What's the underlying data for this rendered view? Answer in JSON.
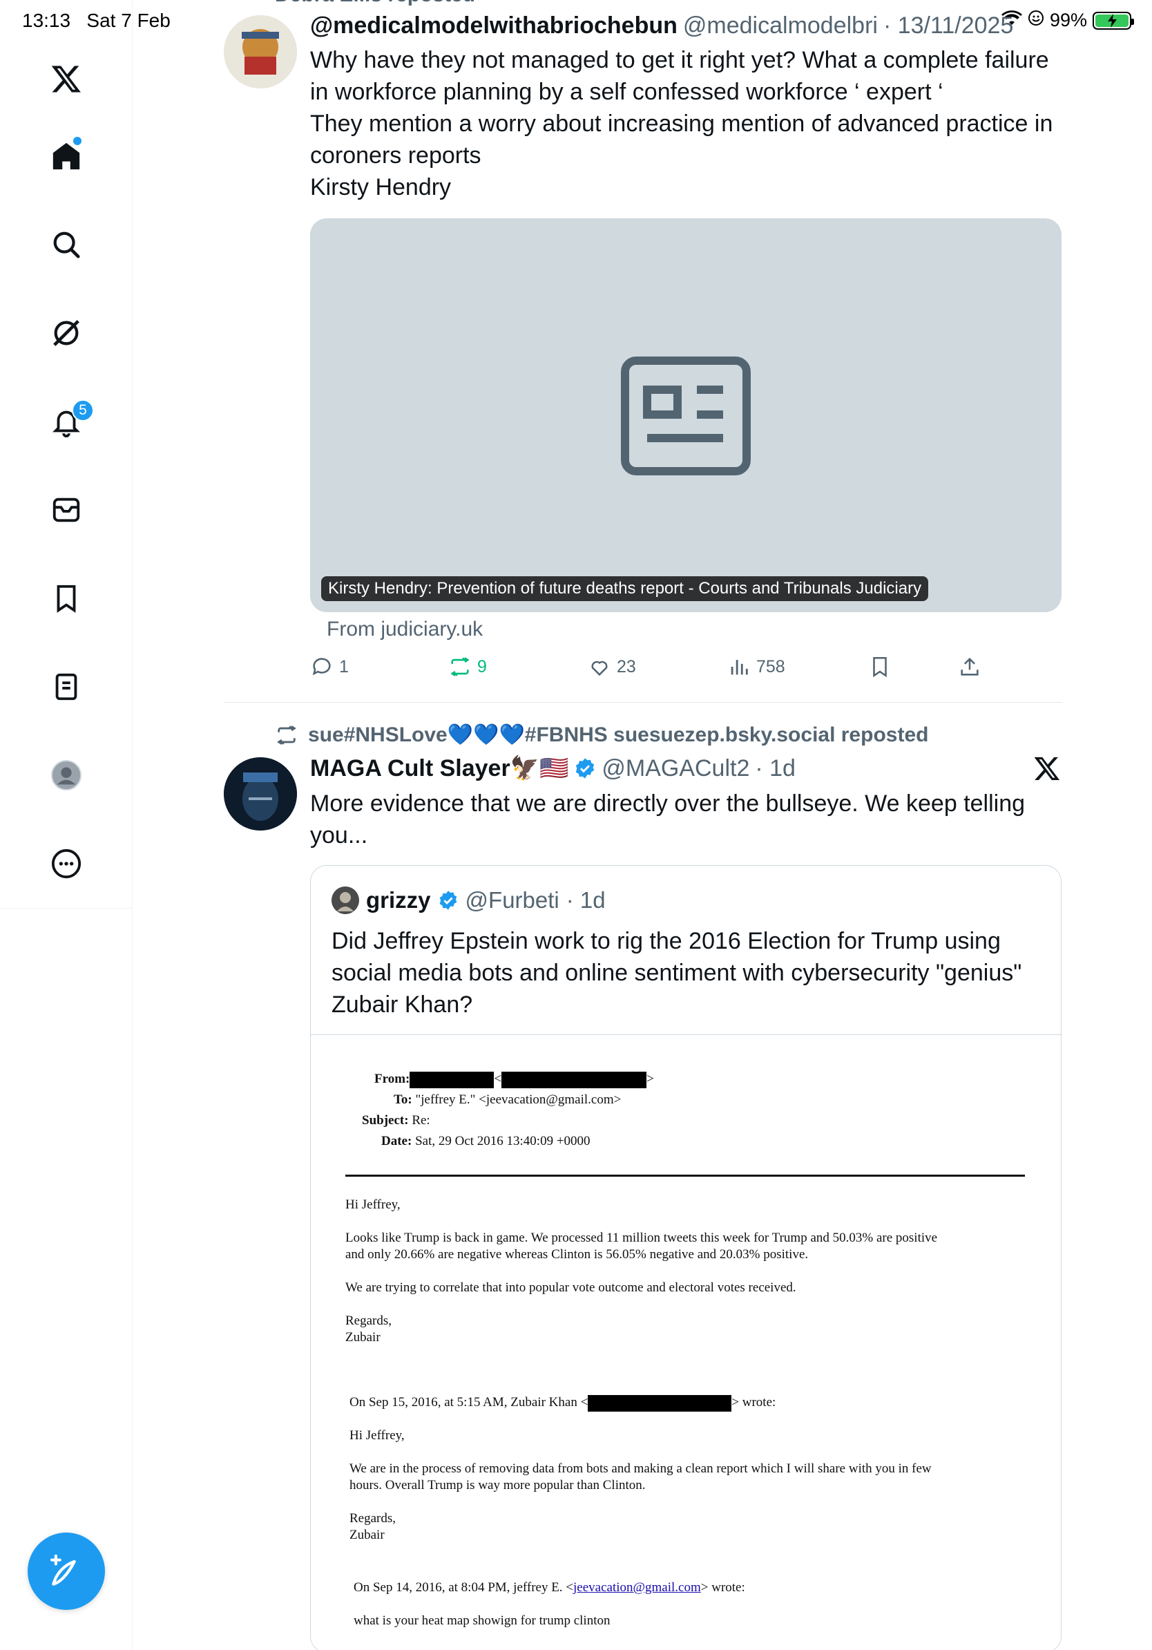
{
  "status": {
    "time": "13:13",
    "date": "Sat 7 Feb",
    "battery": "99%",
    "battery_level": 0.99
  },
  "nav": {
    "items": [
      "X",
      "Home",
      "Search",
      "Grok",
      "Notifications",
      "Messages",
      "Bookmarks",
      "Lists",
      "Profile",
      "More"
    ],
    "notification_count": "5"
  },
  "tweet1": {
    "reposted_by": "Debra Ellis reposted",
    "name": "@medicalmodelwithabriochebun",
    "handle": "@medicalmodelbri",
    "date": "· 13/11/2025",
    "text_lines": [
      "Why have they not managed to get it right yet? What a complete failure",
      "in workforce planning by a self confessed workforce ‘ expert ‘",
      "They mention a worry about increasing mention of advanced practice in",
      "coroners reports",
      "Kirsty Hendry"
    ],
    "card_caption": "Kirsty Hendry: Prevention of future deaths report - Courts and Tribunals Judiciary",
    "card_source": "From judiciary.uk",
    "replies": "1",
    "reposts": "9",
    "likes": "23",
    "views": "758"
  },
  "tweet2": {
    "reposted_by": "sue#NHSLove💙💙💙#FBNHS suesuezep.bsky.social reposted",
    "name": "MAGA Cult Slayer🦅🇺🇸",
    "handle": "@MAGACult2",
    "date": "· 1d",
    "text_lines": [
      "More evidence that we are directly over the bullseye. We keep telling",
      "you..."
    ],
    "quote": {
      "name": "grizzy",
      "handle": "@Furbeti",
      "date": "· 1d",
      "text_lines": [
        "Did Jeffrey Epstein work to rig the 2016 Election for Trump using",
        "social media bots and online sentiment with cybersecurity \"genius\"",
        "Zubair Khan?"
      ],
      "email": {
        "from_label": "From:",
        "to_label": "To:",
        "to_value": "\"jeffrey E.\" <jeevacation@gmail.com>",
        "subject_label": "Subject:",
        "subject_value": "Re:",
        "date_label": "Date:",
        "date_value": "Sat, 29 Oct 2016 13:40:09 +0000",
        "greeting": "Hi Jeffrey,",
        "para1_l1": "Looks like Trump is back in game. We processed 11 million tweets this week for Trump and 50.03% are positive",
        "para1_l2": "and only 20.66% are negative whereas Clinton is 56.05% negative and 20.03% positive.",
        "para2": "We are trying to correlate that into popular vote outcome and electoral votes received.",
        "regards": "Regards,",
        "sign": "Zubair",
        "quote1_prefix": "On Sep 15, 2016, at 5:15 AM, Zubair Khan <",
        "quote1_suffix": "> wrote:",
        "greeting2": "Hi Jeffrey,",
        "para3_l1": "We are in the process of removing data from bots and making a clean report which I will share with you in few",
        "para3_l2": "hours. Overall Trump is way more popular than Clinton.",
        "regards2": "Regards,",
        "sign2": "Zubair",
        "quote2_prefix": "On Sep 14, 2016, at 8:04 PM, jeffrey E. <",
        "quote2_link": "jeevacation@gmail.com",
        "quote2_suffix": "> wrote:",
        "last_line": "what is your heat map showign for trump clinton"
      }
    }
  },
  "colors": {
    "accent": "#1d9bf0",
    "repost_green": "#00ba7c",
    "secondary_text": "#536471"
  }
}
